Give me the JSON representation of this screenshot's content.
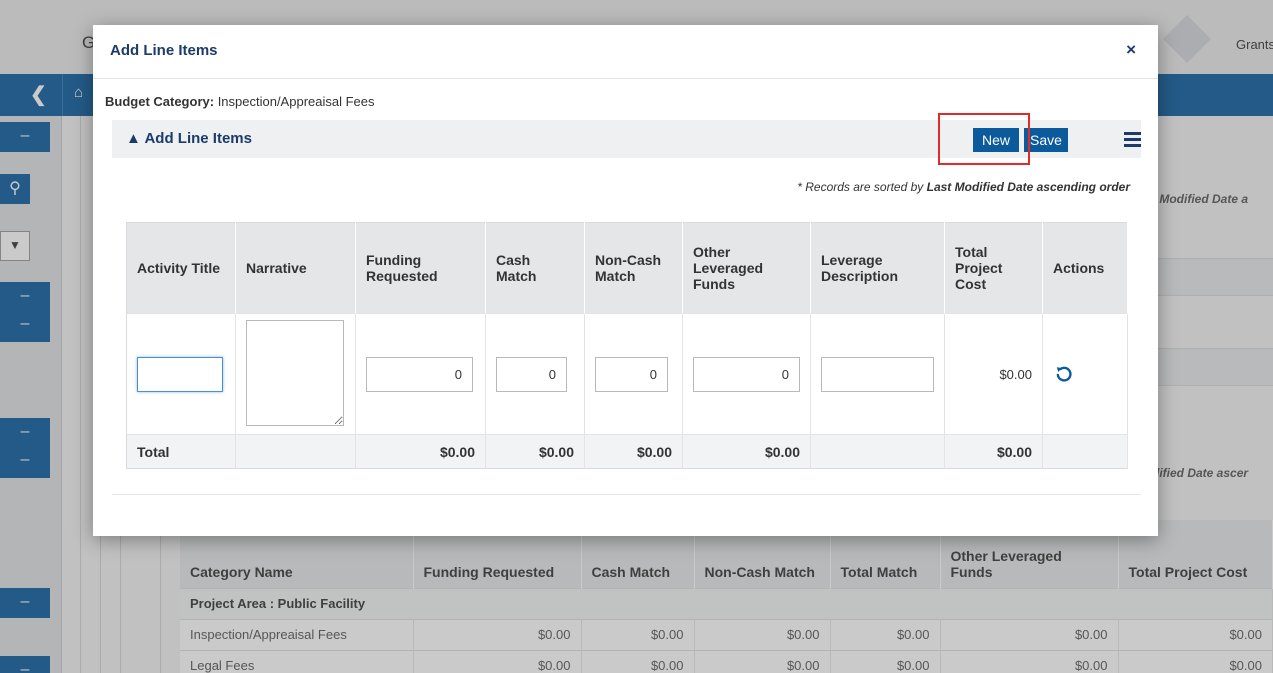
{
  "background": {
    "app_letter": "G",
    "brand_text": "Grants I",
    "right_sort_note_top": "t Modified Date a",
    "right_sort_note_bottom": "dified Date ascer",
    "category_table": {
      "headers": [
        "Category Name",
        "Funding Requested",
        "Cash Match",
        "Non-Cash Match",
        "Total Match",
        "Other Leveraged Funds",
        "Total Project Cost"
      ],
      "group_label": "Project Area : Public Facility",
      "rows": [
        [
          "Inspection/Appreaisal Fees",
          "$0.00",
          "$0.00",
          "$0.00",
          "$0.00",
          "$0.00",
          "$0.00"
        ],
        [
          "Legal Fees",
          "$0.00",
          "$0.00",
          "$0.00",
          "$0.00",
          "$0.00",
          "$0.00"
        ]
      ]
    }
  },
  "modal": {
    "title": "Add Line Items",
    "close_label": "×",
    "budget_category_label": "Budget Category:",
    "budget_category_value": "Inspection/Appreaisal Fees",
    "section_title": "▲ Add Line Items",
    "new_button": "New",
    "save_button": "Save",
    "sort_note_prefix": "* Records are sorted by ",
    "sort_note_bold": "Last Modified Date ascending order",
    "columns": [
      "Activity Title",
      "Narrative",
      "Funding Requested",
      "Cash Match",
      "Non-Cash Match",
      "Other Leveraged Funds",
      "Leverage Description",
      "Total Project Cost",
      "Actions"
    ],
    "row": {
      "activity_title": "",
      "narrative": "",
      "funding_requested": "0",
      "cash_match": "0",
      "non_cash_match": "0",
      "other_leveraged_funds": "0",
      "leverage_description": "",
      "total_project_cost": "$0.00"
    },
    "totals": {
      "label": "Total",
      "funding_requested": "$0.00",
      "cash_match": "$0.00",
      "non_cash_match": "$0.00",
      "other_leveraged_funds": "$0.00",
      "total_project_cost": "$0.00"
    }
  },
  "colors": {
    "primary": "#0a5a9c",
    "title": "#1d3b6a",
    "highlight": "#e02b2b"
  }
}
